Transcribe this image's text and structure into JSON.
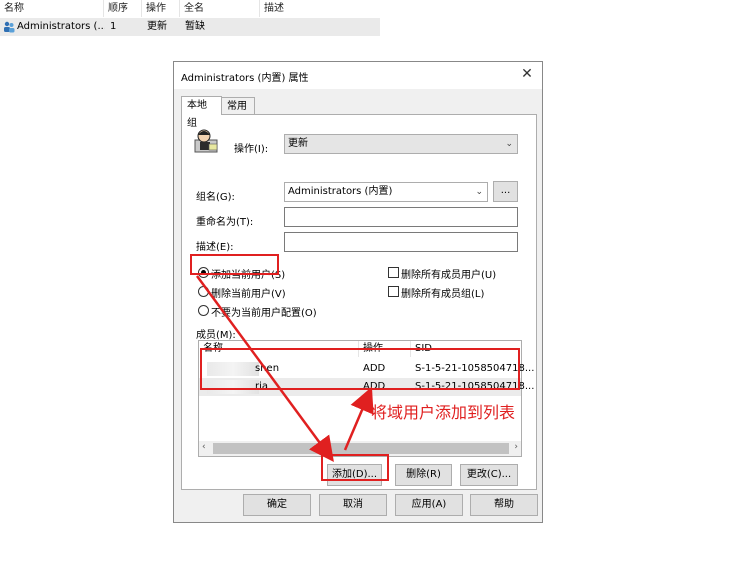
{
  "list": {
    "headers": [
      "名称",
      "顺序",
      "操作",
      "全名",
      "描述"
    ],
    "row": {
      "name": "Administrators (...",
      "order": "1",
      "action": "更新",
      "fullname": "暂缺",
      "desc": ""
    }
  },
  "dialog": {
    "title": "Administrators (内置) 属性",
    "close": "✕",
    "tabs": [
      "本地组",
      "常用"
    ],
    "action_label": "操作(I):",
    "action_value": "更新",
    "group_label": "组名(G):",
    "group_value": "Administrators (内置)",
    "browse_label": "...",
    "rename_label": "重命名为(T):",
    "rename_value": "",
    "desc_label": "描述(E):",
    "desc_value": "",
    "radios": [
      "添加当前用户(S)",
      "删除当前用户(V)",
      "不要为当前用户配置(O)"
    ],
    "checks": [
      "删除所有成员用户(U)",
      "删除所有成员组(L)"
    ],
    "members_label": "成员(M):",
    "members_headers": [
      "名称",
      "操作",
      "SID"
    ],
    "members": [
      {
        "name": "shen",
        "action": "ADD",
        "sid": "S-1-5-21-1058504718..."
      },
      {
        "name": "ria",
        "action": "ADD",
        "sid": "S-1-5-21-1058504718..."
      }
    ],
    "member_buttons": [
      "添加(D)...",
      "删除(R)",
      "更改(C)..."
    ],
    "footer_buttons": [
      "确定",
      "取消",
      "应用(A)",
      "帮助"
    ]
  },
  "annotation": {
    "text": "将域用户添加到列表",
    "color": "#e02020"
  }
}
